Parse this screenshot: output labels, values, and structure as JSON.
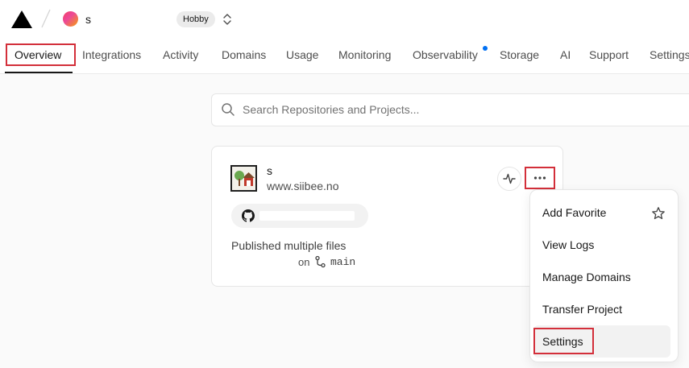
{
  "header": {
    "team_name": "s",
    "plan_badge": "Hobby"
  },
  "nav": {
    "tabs": [
      {
        "label": "Overview",
        "active": true
      },
      {
        "label": "Integrations"
      },
      {
        "label": "Activity"
      },
      {
        "label": "Domains"
      },
      {
        "label": "Usage"
      },
      {
        "label": "Monitoring"
      },
      {
        "label": "Observability",
        "has_notification": true
      },
      {
        "label": "Storage"
      },
      {
        "label": "AI"
      },
      {
        "label": "Support"
      },
      {
        "label": "Settings"
      }
    ]
  },
  "search": {
    "placeholder": "Search Repositories and Projects..."
  },
  "project": {
    "name": "s",
    "url": "www.siibee.no",
    "commit_message": "Published multiple files",
    "commit_prefix": "on",
    "branch": "main",
    "icons": [
      "activity-icon",
      "more-horizontal-icon",
      "github-icon",
      "git-branch-icon"
    ]
  },
  "menu": {
    "items": [
      {
        "label": "Add Favorite",
        "icon": "star-icon"
      },
      {
        "label": "View Logs"
      },
      {
        "label": "Manage Domains"
      },
      {
        "label": "Transfer Project"
      },
      {
        "label": "Settings",
        "hovered": true
      }
    ]
  },
  "colors": {
    "highlight": "#d32f3a",
    "notification": "#0070f3",
    "text": "#171717"
  }
}
